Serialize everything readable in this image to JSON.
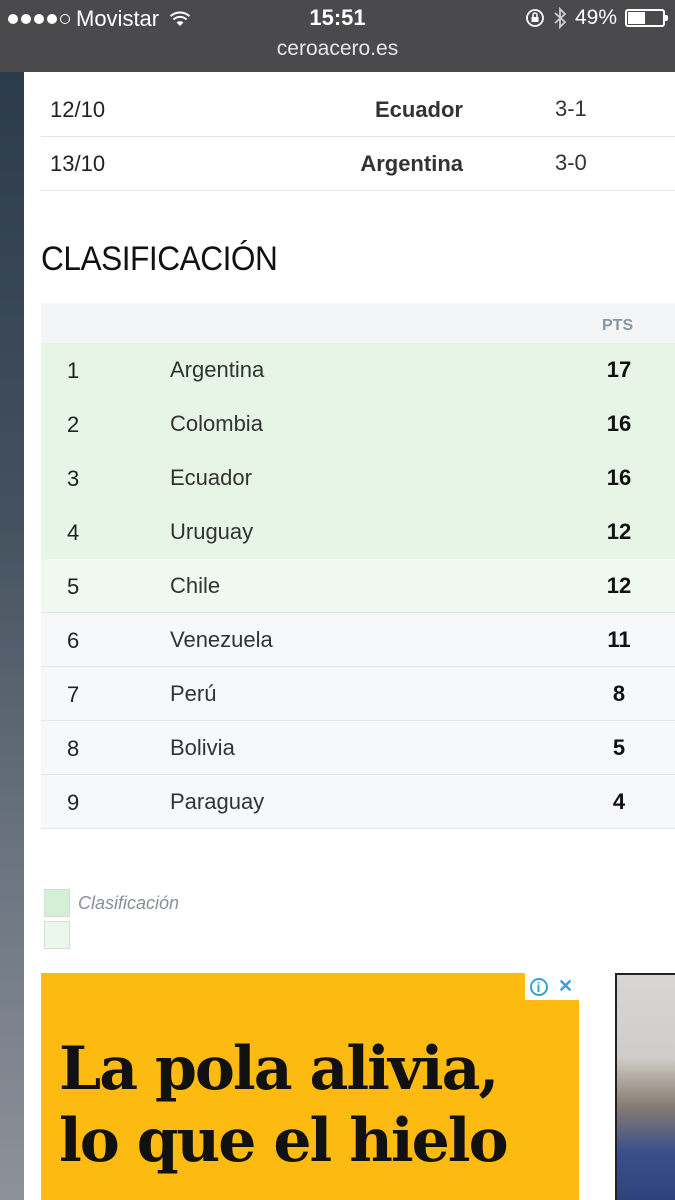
{
  "status_bar": {
    "carrier": "Movistar",
    "time": "15:51",
    "battery": "49%",
    "battery_level": 0.49,
    "url": "ceroacero.es"
  },
  "matches": [
    {
      "date": "12/10",
      "team": "Ecuador",
      "score": "3-1"
    },
    {
      "date": "13/10",
      "team": "Argentina",
      "score": "3-0"
    }
  ],
  "standings": {
    "title": "CLASIFICACIÓN",
    "pts_header": "PTS",
    "rows": [
      {
        "pos": "1",
        "team": "Argentina",
        "pts": "17"
      },
      {
        "pos": "2",
        "team": "Colombia",
        "pts": "16"
      },
      {
        "pos": "3",
        "team": "Ecuador",
        "pts": "16"
      },
      {
        "pos": "4",
        "team": "Uruguay",
        "pts": "12"
      },
      {
        "pos": "5",
        "team": "Chile",
        "pts": "12"
      },
      {
        "pos": "6",
        "team": "Venezuela",
        "pts": "11"
      },
      {
        "pos": "7",
        "team": "Perú",
        "pts": "8"
      },
      {
        "pos": "8",
        "team": "Bolivia",
        "pts": "5"
      },
      {
        "pos": "9",
        "team": "Paraguay",
        "pts": "4"
      }
    ]
  },
  "legend": {
    "items": [
      {
        "label": "Clasificación",
        "color": "#d3efd6"
      },
      {
        "label": "",
        "color": "#eaf7ea"
      }
    ]
  },
  "ad": {
    "line1": "La pola alivia,",
    "line2": "lo que el hielo",
    "background": "#fdbb12",
    "info_icon": "info-icon",
    "close_icon": "close-icon"
  }
}
